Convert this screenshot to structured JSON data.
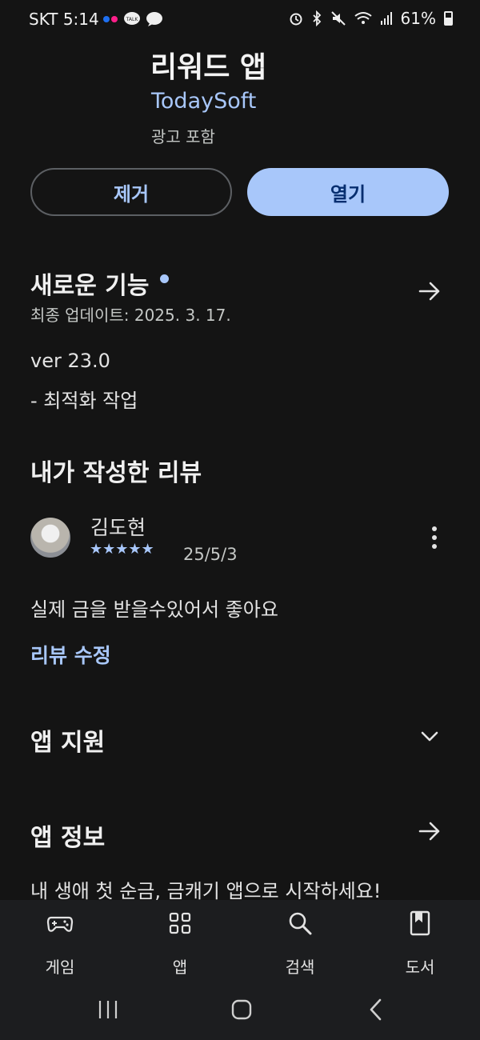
{
  "status_bar": {
    "carrier_time": "SKT 5:14",
    "battery": "61%",
    "icons": [
      "flickr-icon",
      "kakaotalk-icon",
      "chat-bubble-icon",
      "alarm-icon",
      "bluetooth-icon",
      "mute-icon",
      "wifi-icon",
      "signal-icon",
      "battery-icon"
    ]
  },
  "app": {
    "name": "리워드 앱",
    "developer": "TodaySoft",
    "ads_notice": "광고 포함"
  },
  "actions": {
    "remove_label": "제거",
    "open_label": "열기"
  },
  "whats_new": {
    "title": "새로운 기능",
    "updated": "최종 업데이트: 2025. 3. 17.",
    "version": "ver 23.0",
    "notes": "- 최적화 작업"
  },
  "my_review": {
    "title": "내가 작성한 리뷰",
    "author": "김도현",
    "rating": 5,
    "stars": "★★★★★",
    "date": "25/5/3",
    "text": "실제 금을 받을수있어서 좋아요",
    "edit_label": "리뷰 수정"
  },
  "app_support": {
    "title": "앱 지원"
  },
  "app_info": {
    "title": "앱 정보",
    "description": "내 생애 첫 순금, 금캐기 앱으로 시작하세요!"
  },
  "bottom_nav": {
    "items": [
      {
        "label": "게임",
        "icon": "gamepad-icon"
      },
      {
        "label": "앱",
        "icon": "apps-grid-icon"
      },
      {
        "label": "검색",
        "icon": "search-icon"
      },
      {
        "label": "도서",
        "icon": "book-icon"
      }
    ]
  },
  "colors": {
    "accent": "#a8c7fa",
    "background": "#141414",
    "open_button_text": "#062e6f"
  }
}
